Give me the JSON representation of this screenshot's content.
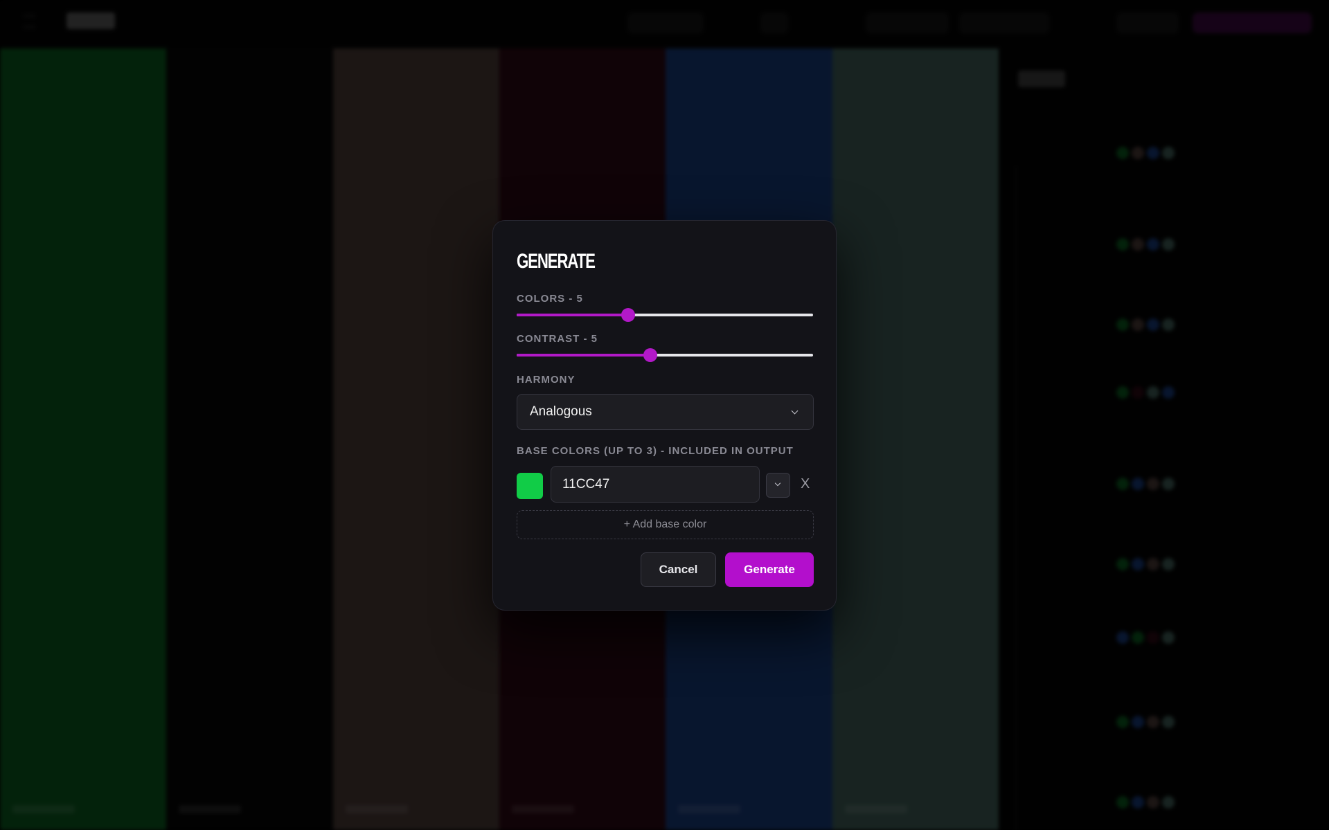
{
  "background": {
    "palette_colors": [
      "#0a5a1e",
      "#060606",
      "#4a3a36",
      "#2c0813",
      "#173a7a",
      "#3f5e57"
    ],
    "accent": "#b219c8"
  },
  "modal": {
    "title": "GENERATE",
    "colors": {
      "label": "COLORS - 5",
      "min": 2,
      "max": 10,
      "value": 5
    },
    "contrast": {
      "label": "CONTRAST - 5",
      "min": 0,
      "max": 10,
      "value": 4.5
    },
    "harmony": {
      "label": "HARMONY",
      "selected": "Analogous"
    },
    "base_colors": {
      "label": "BASE COLORS (UP TO 3) - INCLUDED IN OUTPUT",
      "items": [
        {
          "hex": "11CC47",
          "swatch": "#11cc47",
          "remove_label": "X"
        }
      ],
      "add_label": "+ Add base color"
    },
    "buttons": {
      "cancel": "Cancel",
      "generate": "Generate"
    }
  }
}
